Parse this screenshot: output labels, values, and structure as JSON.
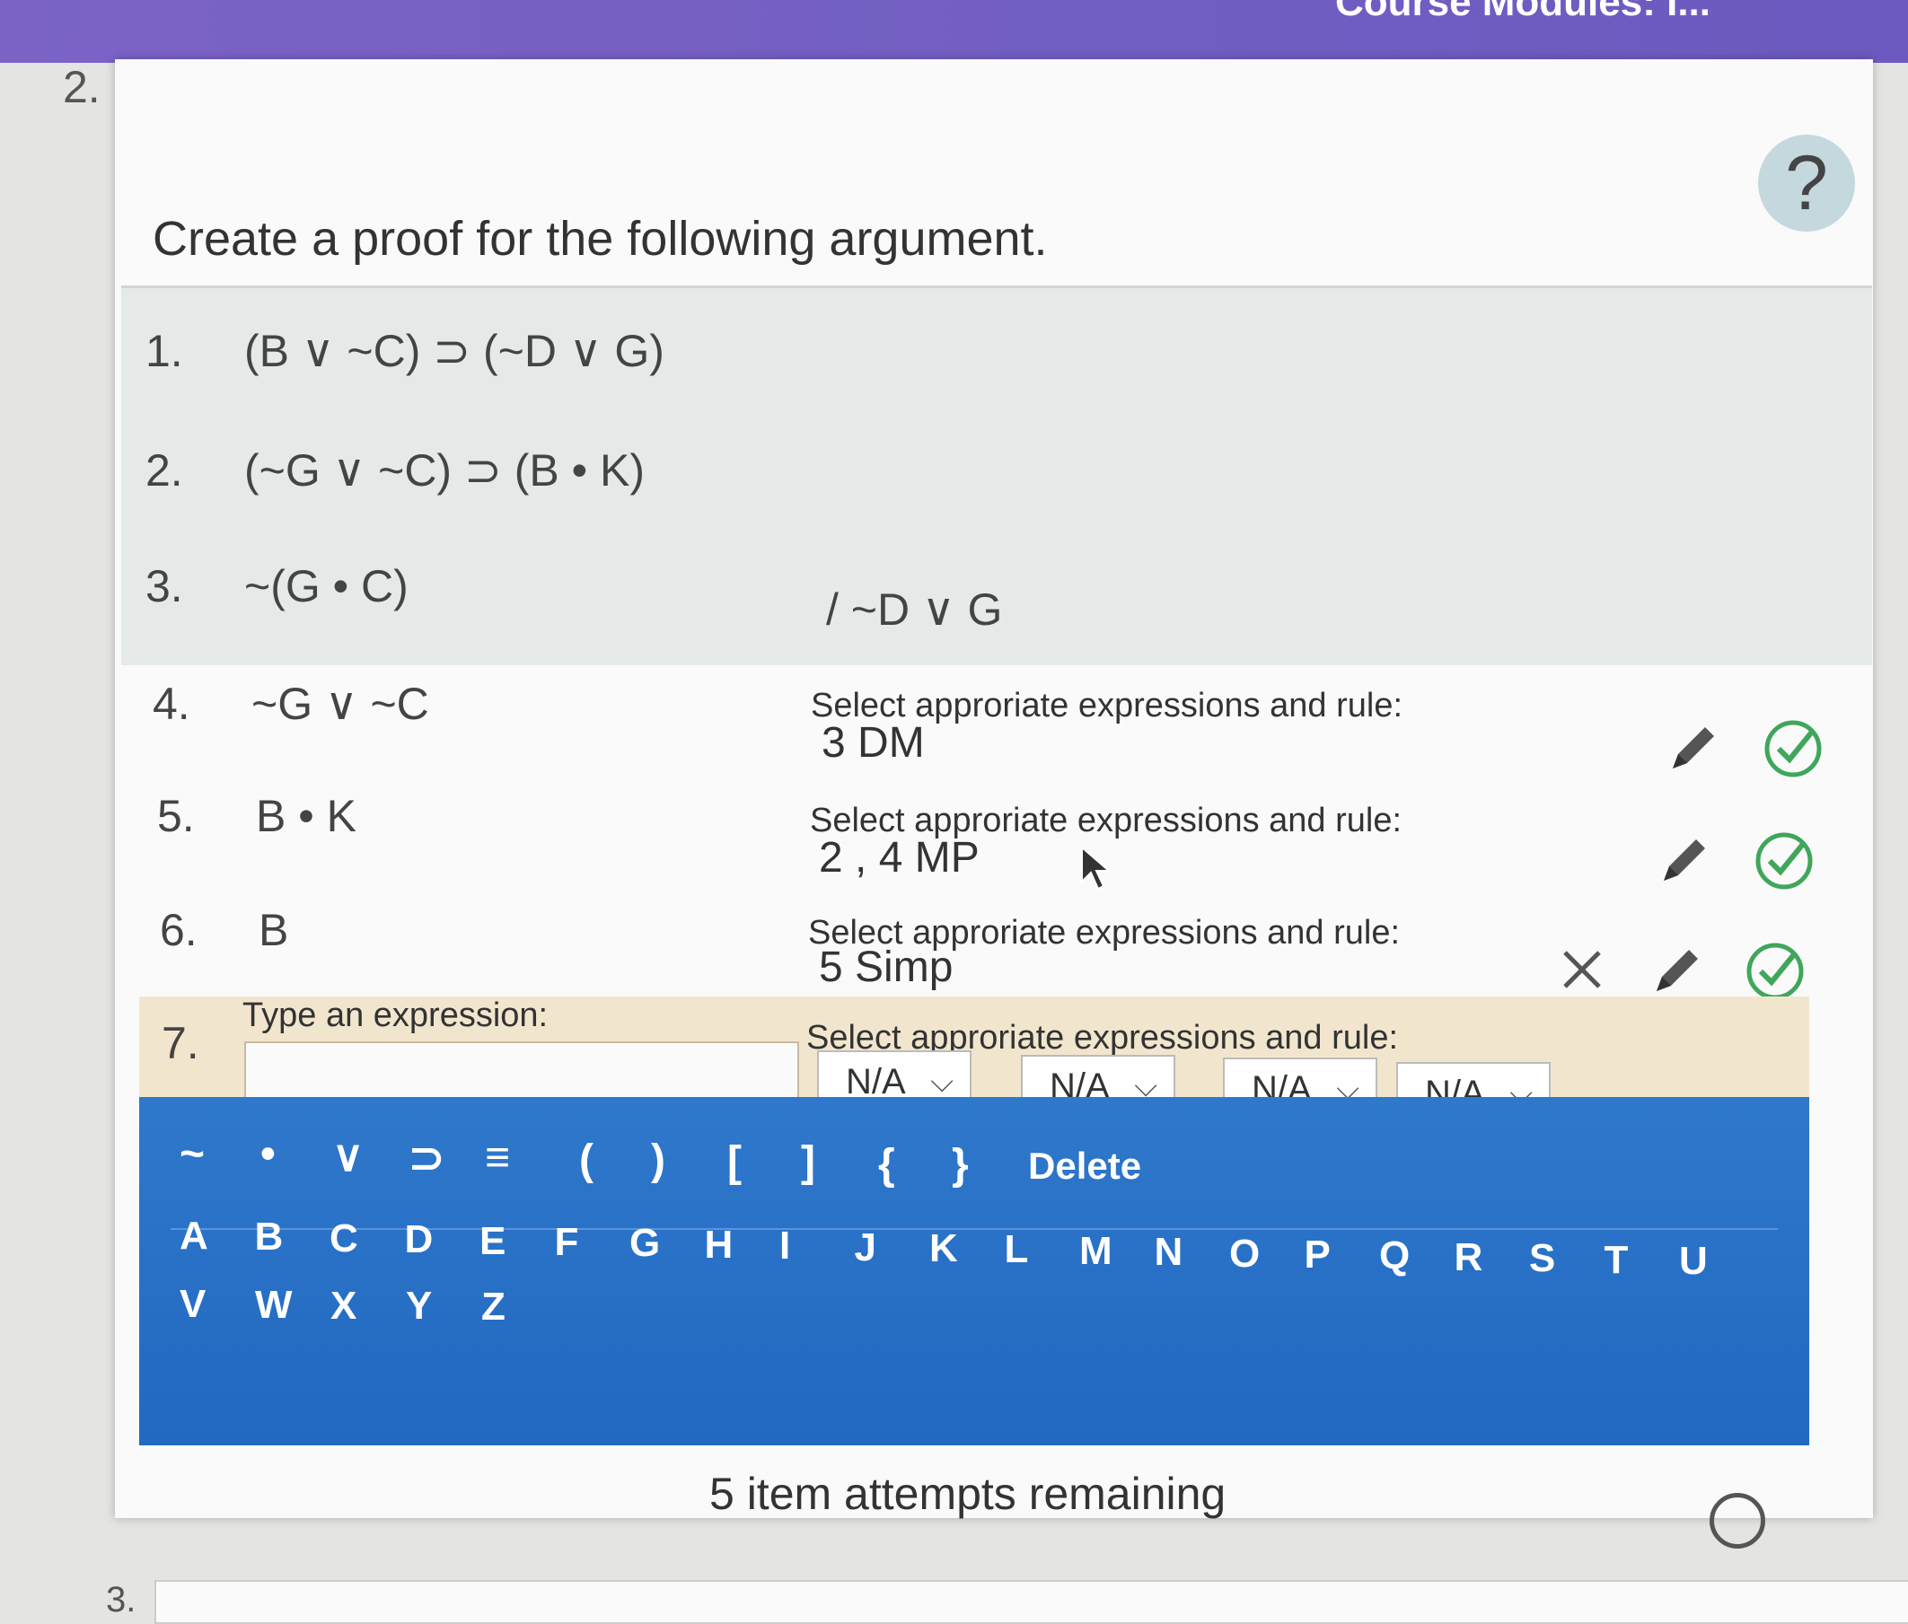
{
  "header": {
    "course_text": "Course Modules: I..."
  },
  "question_number": "2.",
  "next_question_number": "3.",
  "help_label": "?",
  "prompt": "Create a proof for the following argument.",
  "premises": [
    {
      "num": "1.",
      "expr": "(B ∨ ~C) ⊃ (~D ∨ G)"
    },
    {
      "num": "2.",
      "expr": "(~G ∨ ~C) ⊃ (B • K)"
    },
    {
      "num": "3.",
      "expr": "~(G • C)"
    }
  ],
  "conclusion": "/ ~D ∨ G",
  "steps": [
    {
      "num": "4.",
      "expr": "~G ∨ ~C",
      "label": "Select approriate expressions and rule:",
      "justification": "3  DM"
    },
    {
      "num": "5.",
      "expr": "B • K",
      "label": "Select approriate expressions and rule:",
      "justification": "2 , 4  MP"
    },
    {
      "num": "6.",
      "expr": "B",
      "label": "Select approriate expressions and rule:",
      "justification": "5  Simp"
    }
  ],
  "row7": {
    "num": "7.",
    "expr_label": "Type an expression:",
    "expr_value": "",
    "rule_label": "Select approriate expressions and rule:",
    "dropdowns": [
      "N/A",
      "N/A",
      "N/A",
      "N/A"
    ],
    "separator": ","
  },
  "keyboard": {
    "symbols": [
      "~",
      "•",
      "∨",
      "⊃",
      "≡",
      "(",
      ")",
      "[",
      "]",
      "{",
      "}"
    ],
    "delete_label": "Delete",
    "letters": [
      "A",
      "B",
      "C",
      "D",
      "E",
      "F",
      "G",
      "H",
      "I",
      "J",
      "K",
      "L",
      "M",
      "N",
      "O",
      "P",
      "Q",
      "R",
      "S",
      "T",
      "U",
      "V",
      "W",
      "X",
      "Y",
      "Z"
    ]
  },
  "attempts_text": "5 item attempts remaining",
  "colors": {
    "accent": "#2169c1",
    "header": "#7b63c6",
    "row7": "#f1e6cd",
    "check": "#3fa65a"
  },
  "icons": [
    "pencil-icon",
    "check-circle-icon",
    "delete-x-icon",
    "help-icon",
    "circle-icon"
  ]
}
